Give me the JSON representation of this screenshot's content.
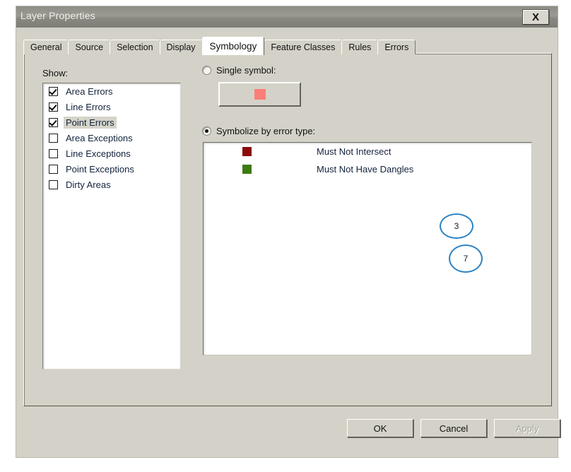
{
  "window": {
    "title": "Layer Properties",
    "close_label": "X",
    "close_icon": "close-icon"
  },
  "tabs": [
    {
      "label": "General",
      "active": false
    },
    {
      "label": "Source",
      "active": false
    },
    {
      "label": "Selection",
      "active": false
    },
    {
      "label": "Display",
      "active": false
    },
    {
      "label": "Symbology",
      "active": true
    },
    {
      "label": "Feature Classes",
      "active": false
    },
    {
      "label": "Rules",
      "active": false
    },
    {
      "label": "Errors",
      "active": false
    }
  ],
  "symbology": {
    "show_label": "Show:",
    "show_items": [
      {
        "label": "Area Errors",
        "checked": true,
        "selected": false
      },
      {
        "label": "Line Errors",
        "checked": true,
        "selected": false
      },
      {
        "label": "Point Errors",
        "checked": true,
        "selected": true
      },
      {
        "label": "Area Exceptions",
        "checked": false,
        "selected": false
      },
      {
        "label": "Line Exceptions",
        "checked": false,
        "selected": false
      },
      {
        "label": "Point Exceptions",
        "checked": false,
        "selected": false
      },
      {
        "label": "Dirty Areas",
        "checked": false,
        "selected": false
      }
    ],
    "single_symbol": {
      "label": "Single symbol:",
      "selected": false,
      "swatch_color": "#fa7f78"
    },
    "symbolize_by_type": {
      "label": "Symbolize by error type:",
      "selected": true
    },
    "legend_rows": [
      {
        "label": "Must Not Intersect",
        "color": "#8b0b0b"
      },
      {
        "label": "Must Not Have Dangles",
        "color": "#3d7a12"
      }
    ]
  },
  "annotations": [
    {
      "text": "3",
      "color": "#2e84c4"
    },
    {
      "text": "7",
      "color": "#2e84c4"
    }
  ],
  "footer": {
    "ok": "OK",
    "cancel": "Cancel",
    "apply": "Apply"
  }
}
